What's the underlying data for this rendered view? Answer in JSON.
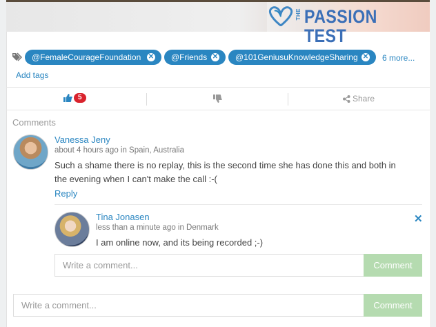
{
  "banner": {
    "logo_word_small": "THE",
    "logo_word": "PASSION TEST"
  },
  "tags": {
    "items": [
      {
        "label": "@FemaleCourageFoundation"
      },
      {
        "label": "@Friends"
      },
      {
        "label": "@101GeniusuKnowledgeSharing"
      }
    ],
    "more": "6 more...",
    "add": "Add tags"
  },
  "actions": {
    "like_count": "5",
    "share": "Share"
  },
  "comments": {
    "title": "Comments",
    "first": {
      "author": "Vanessa Jeny",
      "meta": "about 4 hours ago in Spain, Australia",
      "text_line1": "Such a shame there is no replay, this is the second time she has done this and both in",
      "text_line2": "the evening when I can't make the call :-(",
      "reply": "Reply"
    },
    "nested": {
      "author": "Tina Jonasen",
      "meta": "less than a minute ago in Denmark",
      "text": "I am online now, and its being recorded ;-)"
    },
    "reply_input_placeholder": "Write a comment...",
    "reply_button": "Comment",
    "main_input_placeholder": "Write a comment...",
    "main_button": "Comment"
  },
  "colors": {
    "accent": "#2a86c1",
    "badge": "#d9232d",
    "button": "#b5dbb0"
  }
}
